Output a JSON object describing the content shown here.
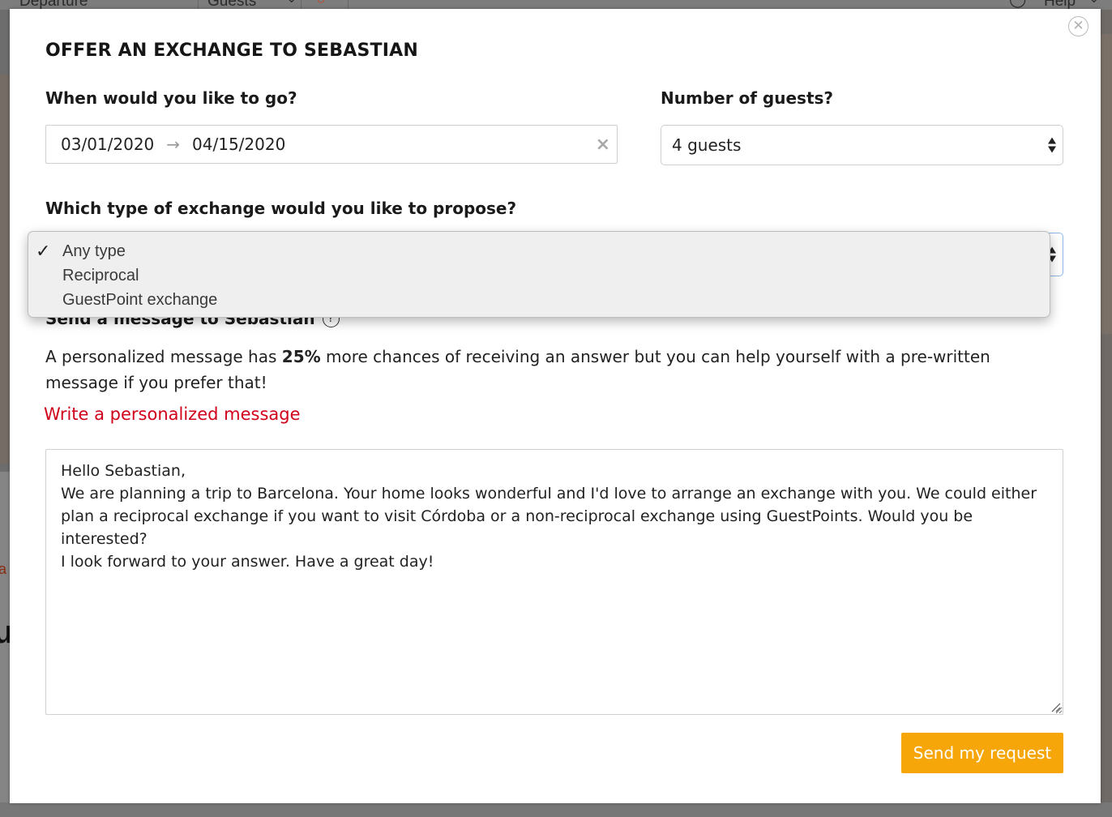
{
  "background": {
    "departure_label": "Departure",
    "guests_label": "Guests",
    "help_label": "Help"
  },
  "modal": {
    "title": "OFFER AN EXCHANGE TO SEBASTIAN",
    "close_icon": "close-icon",
    "dates": {
      "label": "When would you like to go?",
      "start": "03/01/2020",
      "arrow": "→",
      "end": "04/15/2020",
      "clear_icon": "×"
    },
    "guests": {
      "label": "Number of guests?",
      "selected": "4 guests"
    },
    "exchange_type": {
      "label": "Which type of exchange would you like to propose?",
      "options": [
        {
          "label": "Any type",
          "checked": true
        },
        {
          "label": "Reciprocal",
          "checked": false
        },
        {
          "label": "GuestPoint exchange",
          "checked": false
        }
      ]
    },
    "message": {
      "label": "Send a message to Sebastian",
      "help_icon": "?",
      "info_before": "A personalized message has ",
      "info_bold": "25%",
      "info_after": " more chances of receiving an answer but you can help yourself with a pre-written message if you prefer that!",
      "link": "Write a personalized message",
      "body_lines": [
        "Hello Sebastian,",
        "We are planning a trip to Barcelona. Your home looks wonderful and I'd love to arrange an exchange with you. We could either plan a reciprocal exchange if you want to visit Córdoba or a non-reciprocal exchange using GuestPoints. Would you be interested?",
        "I look forward to your answer. Have a great day!"
      ]
    },
    "send_button": "Send my request"
  },
  "colors": {
    "accent": "#f6a609",
    "link": "#d0021b"
  }
}
